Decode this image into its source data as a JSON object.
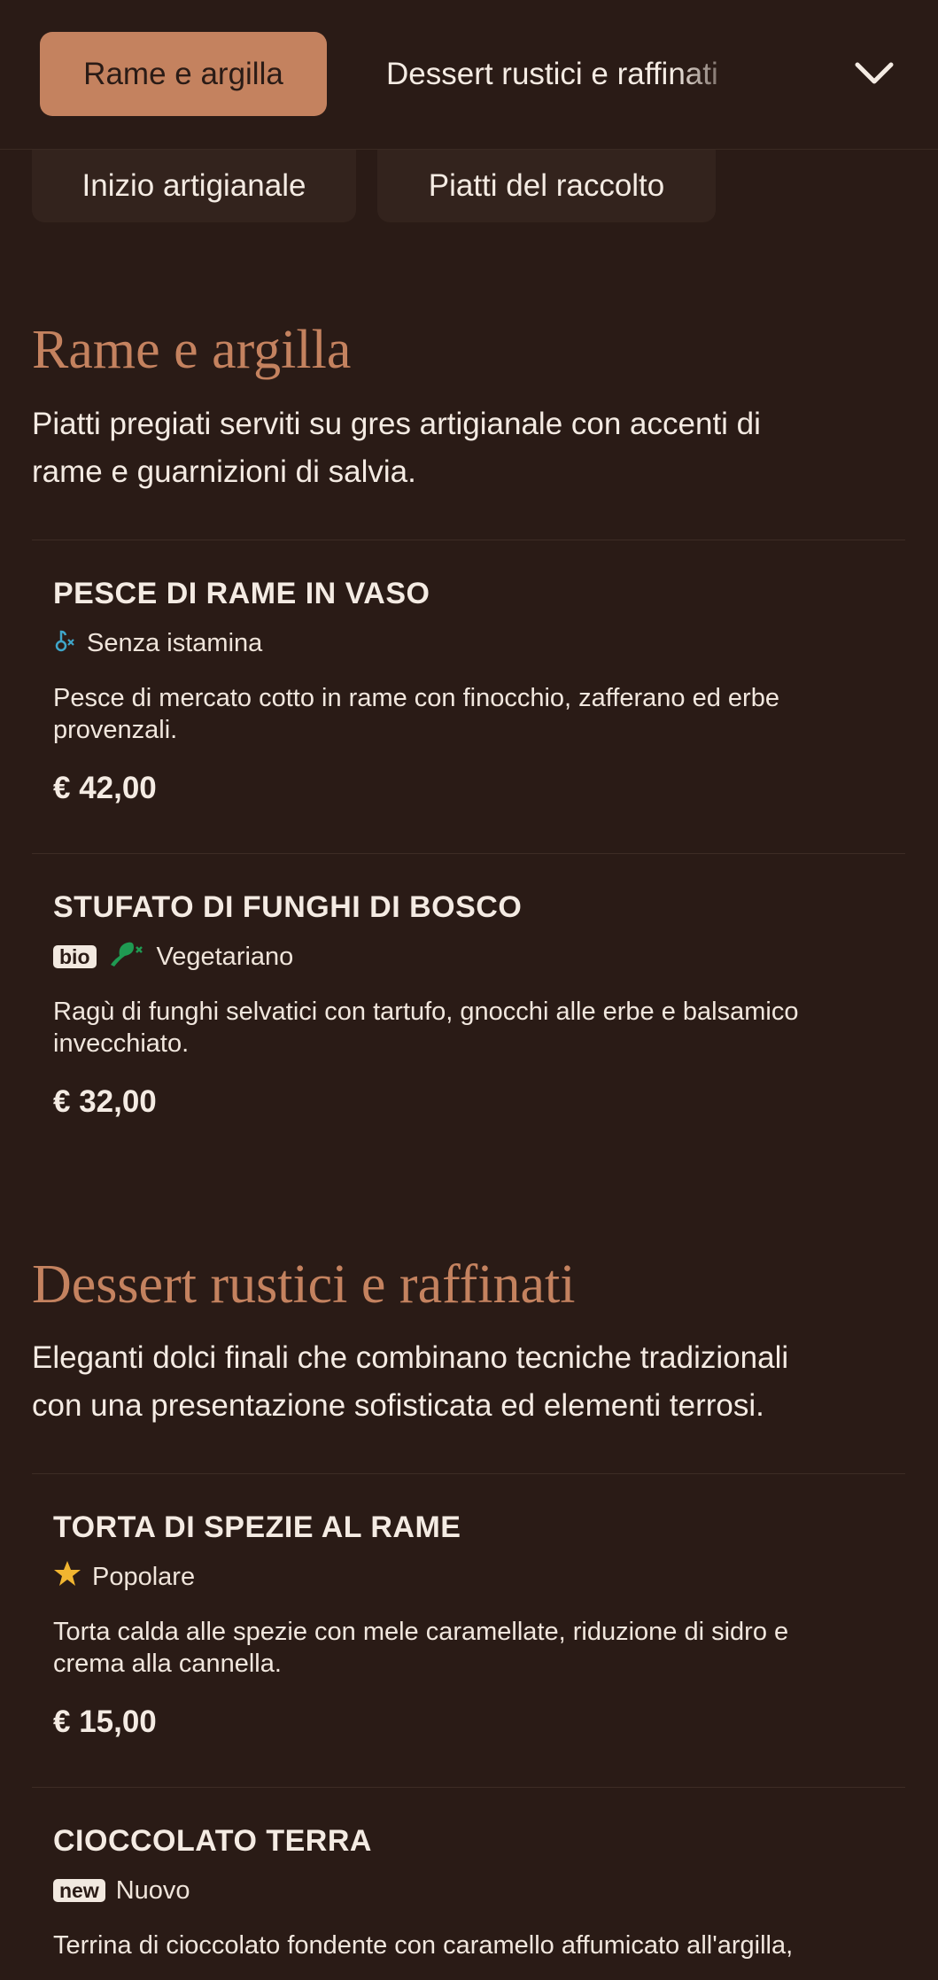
{
  "nav": {
    "active_tab": "Rame e argilla",
    "next_tab": "Dessert rustici e raffinati",
    "sub_tabs": [
      "Inizio artigianale",
      "Piatti del raccolto"
    ]
  },
  "sections": [
    {
      "title": "Rame e argilla",
      "description_lines": [
        "Piatti pregiati serviti su gres artigianale con accenti di",
        "rame e guarnizioni di salvia."
      ],
      "items": [
        {
          "name": "PESCE DI RAME IN VASO",
          "badge": "",
          "icon": "histamine-free-icon",
          "tag": "Senza istamina",
          "description_lines": [
            "Pesce di mercato cotto in rame con finocchio, zafferano ed erbe",
            "provenzali."
          ],
          "price": "€ 42,00"
        },
        {
          "name": "STUFATO DI FUNGHI DI BOSCO",
          "badge": "bio",
          "icon": "vegetarian-icon",
          "tag": "Vegetariano",
          "description_lines": [
            "Ragù di funghi selvatici con tartufo, gnocchi alle erbe e balsamico",
            "invecchiato."
          ],
          "price": "€ 32,00"
        }
      ]
    },
    {
      "title": "Dessert rustici e raffinati",
      "description_lines": [
        "Eleganti dolci finali che combinano tecniche tradizionali",
        "con una presentazione sofisticata ed elementi terrosi."
      ],
      "items": [
        {
          "name": "TORTA DI SPEZIE AL RAME",
          "badge": "",
          "icon": "star-icon",
          "tag": "Popolare",
          "description_lines": [
            "Torta calda alle spezie con mele caramellate, riduzione di sidro e",
            "crema alla cannella."
          ],
          "price": "€ 15,00"
        },
        {
          "name": "CIOCCOLATO TERRA",
          "badge": "new",
          "icon": "",
          "tag": "Nuovo",
          "description_lines": [
            "Terrina di cioccolato fondente con caramello affumicato all'argilla,"
          ],
          "price": ""
        }
      ]
    }
  ],
  "colors": {
    "background": "#2a1b16",
    "accent": "#c4825f",
    "text": "#f4ebe3",
    "vegetarian": "#1f9a52",
    "histamine": "#3fa6c9",
    "star": "#f1b530"
  }
}
